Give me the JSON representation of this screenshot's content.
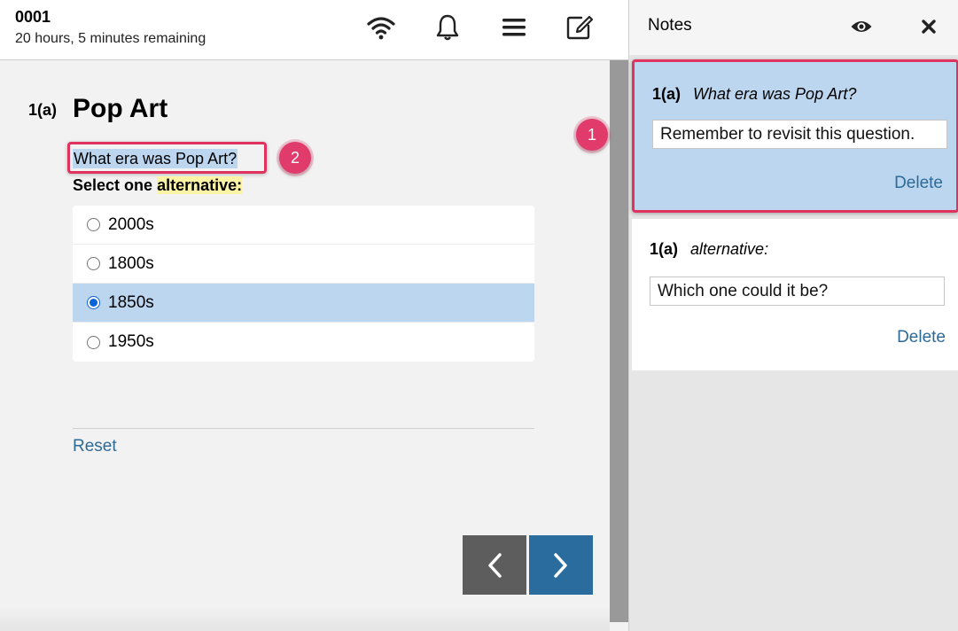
{
  "header": {
    "candidate_id": "0001",
    "time_remaining": "20 hours, 5 minutes remaining",
    "icons": [
      "wifi-icon",
      "bell-icon",
      "menu-icon",
      "edit-note-icon"
    ]
  },
  "question": {
    "number": "1(a)",
    "title": "Pop Art",
    "text": "What era was Pop Art?",
    "instruction_prefix": "Select one",
    "instruction_highlight": "alternative:",
    "options": [
      {
        "label": "2000s",
        "selected": false
      },
      {
        "label": "1800s",
        "selected": false
      },
      {
        "label": "1850s",
        "selected": true
      },
      {
        "label": "1950s",
        "selected": false
      }
    ],
    "reset_label": "Reset"
  },
  "badges": {
    "one": "1",
    "two": "2"
  },
  "notes": {
    "title": "Notes",
    "items": [
      {
        "ref": "1(a)",
        "quote": "What era was Pop Art?",
        "text": "Remember to revisit this question.",
        "delete_label": "Delete"
      },
      {
        "ref": "1(a)",
        "quote": "alternative:",
        "text": "Which one could it be?",
        "delete_label": "Delete"
      }
    ]
  },
  "colors": {
    "accent": "#2b6c9e",
    "highlight_blue": "#bcd6f0",
    "badge_pink": "#e03b6a",
    "yellow_highlight": "#fbf3a6"
  }
}
